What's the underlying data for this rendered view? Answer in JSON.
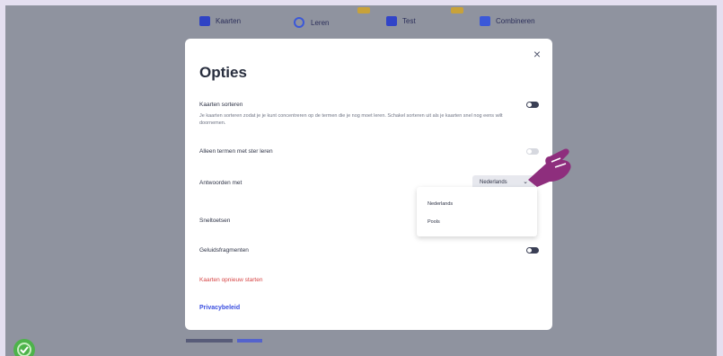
{
  "nav": {
    "items": [
      {
        "label": "Kaarten",
        "color": "#2f43c4"
      },
      {
        "label": "Leren",
        "color": "#3b58d8"
      },
      {
        "label": "Test",
        "color": "#3144c8"
      },
      {
        "label": "Combineren",
        "color": "#3b58d8"
      }
    ]
  },
  "modal": {
    "title": "Opties",
    "close_icon": "×",
    "sort_cards_label": "Kaarten sorteren",
    "sort_cards_desc": "Je kaarten sorteren zodat je je kunt concentreren op de termen die je nog moet leren. Schakel sorteren uit als je kaarten snel nog eens wilt doornemen.",
    "only_starred_label": "Alleen termen met ster leren",
    "answer_with_label": "Antwoorden met",
    "answer_with_value": "Nederlands",
    "dropdown_options": [
      "Nederlands",
      "Pools"
    ],
    "shortcuts_label": "Sneltoetsen",
    "audio_label": "Geluidsfragmenten",
    "restart_link": "Kaarten opnieuw starten",
    "privacy_link": "Privacybeleid"
  },
  "colors": {
    "accent": "#3b4fe0",
    "danger": "#d64545",
    "cursor": "#8e2e7d"
  }
}
